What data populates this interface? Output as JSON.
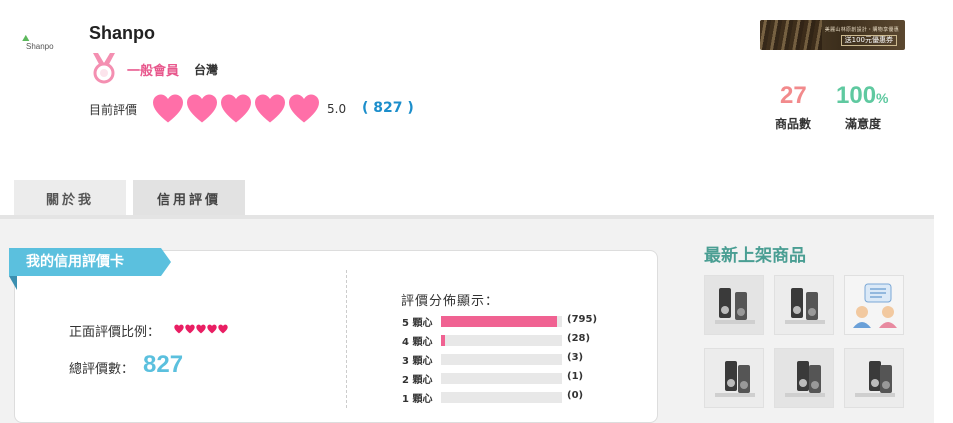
{
  "shop": {
    "logo_text": "Shanpo",
    "name": "Shanpo",
    "member_level": "一般會員",
    "region": "台灣",
    "rating_label": "目前評價",
    "rating_score": "5.0",
    "review_count": "( 827 )",
    "hearts_filled": 5
  },
  "banner": {
    "line1": "美麗山林原創設計・購物享優惠",
    "line2": "送100元優惠券"
  },
  "stats": {
    "products_count": "27",
    "products_label": "商品數",
    "satisfaction_value": "100",
    "satisfaction_unit": "%",
    "satisfaction_label": "滿意度"
  },
  "tabs": [
    {
      "label": "關於我"
    },
    {
      "label": "信用評價"
    }
  ],
  "credit_card": {
    "title": "我的信用評價卡",
    "positive_label": "正面評價比例：",
    "positive_hearts": 5,
    "total_label": "總評價數：",
    "total_value": "827"
  },
  "distribution": {
    "title": "評價分佈顯示：",
    "rows": [
      {
        "label": "5 顆心",
        "count": "(795)",
        "ratio": 0.96
      },
      {
        "label": "4 顆心",
        "count": "(28)",
        "ratio": 0.034
      },
      {
        "label": "3 顆心",
        "count": "(3)",
        "ratio": 0
      },
      {
        "label": "2 顆心",
        "count": "(1)",
        "ratio": 0
      },
      {
        "label": "1 顆心",
        "count": "(0)",
        "ratio": 0
      }
    ]
  },
  "sidebar": {
    "title": "最新上架商品",
    "products": [
      {
        "icon": "speaker-product-icon"
      },
      {
        "icon": "speaker-product-icon"
      },
      {
        "icon": "chat-people-icon"
      },
      {
        "icon": "speaker-product-icon"
      },
      {
        "icon": "speaker-product-icon"
      },
      {
        "icon": "speaker-product-icon"
      }
    ]
  },
  "colors": {
    "pink": "#f06292",
    "heart": "#ff6fa8",
    "teal": "#5bc0de",
    "blue": "#1c8ecb",
    "green": "#5fc9a0",
    "coral": "#f28a8c"
  }
}
